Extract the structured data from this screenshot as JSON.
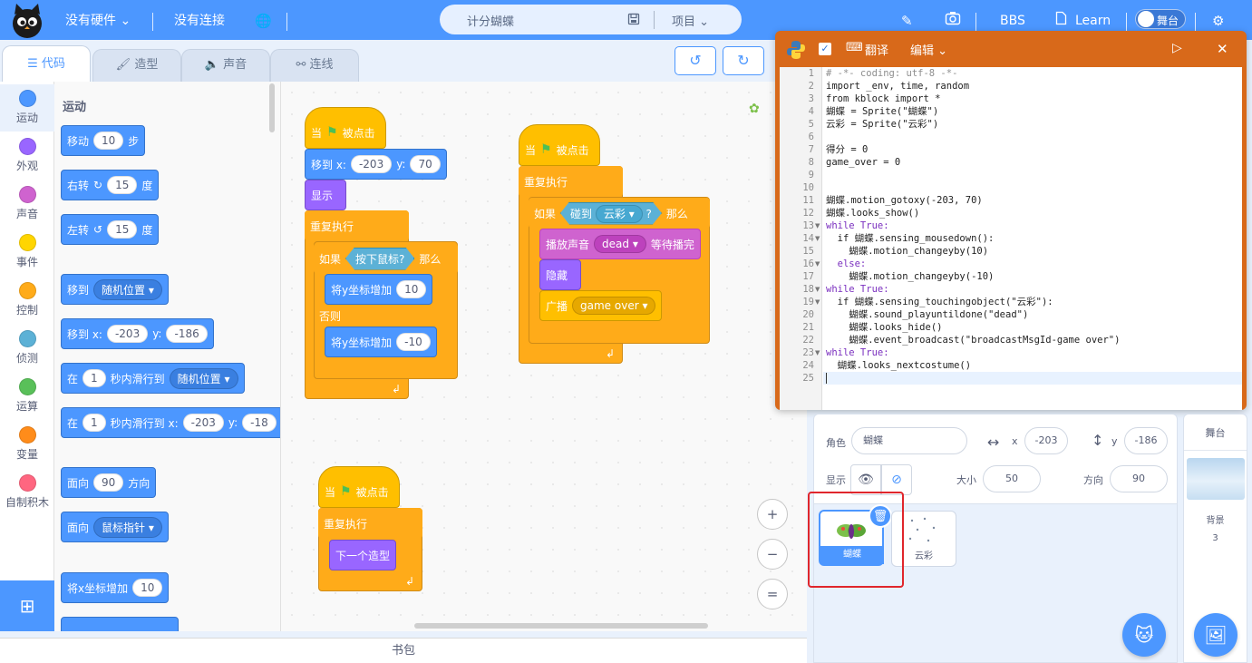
{
  "topbar": {
    "hardware": "没有硬件",
    "connection": "没有连接",
    "project_name": "计分蝴蝶",
    "project_menu": "项目",
    "bbs": "BBS",
    "learn": "Learn",
    "stage_toggle": "舞台"
  },
  "tabs": [
    "代码",
    "造型",
    "声音",
    "连线"
  ],
  "categories": [
    {
      "label": "运动",
      "color": "#4c97ff"
    },
    {
      "label": "外观",
      "color": "#9966ff"
    },
    {
      "label": "声音",
      "color": "#cf63cf"
    },
    {
      "label": "事件",
      "color": "#ffd500"
    },
    {
      "label": "控制",
      "color": "#ffab19"
    },
    {
      "label": "侦测",
      "color": "#5cb1d6"
    },
    {
      "label": "运算",
      "color": "#59c059"
    },
    {
      "label": "变量",
      "color": "#ff8c1a"
    },
    {
      "label": "自制积木",
      "color": "#ff6680"
    }
  ],
  "palette": {
    "title": "运动",
    "move": {
      "pre": "移动",
      "val": "10",
      "post": "步"
    },
    "turn_right": {
      "pre": "右转",
      "val": "15",
      "post": "度"
    },
    "turn_left": {
      "pre": "左转",
      "val": "15",
      "post": "度"
    },
    "goto_random": {
      "pre": "移到",
      "drop": "随机位置"
    },
    "goto_xy": {
      "pre": "移到 x:",
      "x": "-203",
      "ylabel": "y:",
      "y": "-186"
    },
    "glide_random": {
      "pre": "在",
      "val": "1",
      "mid": "秒内滑行到",
      "drop": "随机位置"
    },
    "glide_xy": {
      "pre": "在",
      "val": "1",
      "mid": "秒内滑行到 x:",
      "x": "-203",
      "ylabel": "y:",
      "y": "-18"
    },
    "point_dir": {
      "pre": "面向",
      "val": "90",
      "post": "方向"
    },
    "point_toward": {
      "pre": "面向",
      "drop": "鼠标指针"
    },
    "change_x": {
      "pre": "将x坐标增加",
      "val": "10"
    }
  },
  "script1": {
    "hat_pre": "当",
    "hat_post": "被点击",
    "goto_pre": "移到 x:",
    "goto_x": "-203",
    "goto_ylabel": "y:",
    "goto_y": "70",
    "show": "显示",
    "forever": "重复执行",
    "if": "如果",
    "cond": "按下鼠标?",
    "then": "那么",
    "change_y1_pre": "将y坐标增加",
    "change_y1_val": "10",
    "else": "否则",
    "change_y2_pre": "将y坐标增加",
    "change_y2_val": "-10"
  },
  "script2": {
    "hat_pre": "当",
    "hat_post": "被点击",
    "forever": "重复执行",
    "if": "如果",
    "touch_pre": "碰到",
    "touch_drop": "云彩",
    "touch_q": "?",
    "then": "那么",
    "sound_pre": "播放声音",
    "sound_drop": "dead",
    "sound_post": "等待播完",
    "hide": "隐藏",
    "broadcast_pre": "广播",
    "broadcast_drop": "game over"
  },
  "script3": {
    "hat_pre": "当",
    "hat_post": "被点击",
    "forever": "重复执行",
    "next": "下一个造型"
  },
  "zoom": {
    "in": "+",
    "out": "−",
    "reset": "="
  },
  "backpack": "书包",
  "python": {
    "translate": "翻译",
    "edit": "编辑",
    "line_numbers": [
      "1",
      "2",
      "3",
      "4",
      "5",
      "6",
      "7",
      "8",
      "9",
      "10",
      "11",
      "12",
      "13",
      "14",
      "15",
      "16",
      "17",
      "18",
      "19",
      "20",
      "21",
      "22",
      "23",
      "24",
      "25"
    ],
    "lines": [
      "# -*- coding: utf-8 -*-",
      "import _env, time, random",
      "from kblock import *",
      "蝴蝶 = Sprite(\"蝴蝶\")",
      "云彩 = Sprite(\"云彩\")",
      "",
      "得分 = 0",
      "game_over = 0",
      "",
      "",
      "蝴蝶.motion_gotoxy(-203, 70)",
      "蝴蝶.looks_show()",
      "while True:",
      "  if 蝴蝶.sensing_mousedown():",
      "    蝴蝶.motion_changeyby(10)",
      "  else:",
      "    蝴蝶.motion_changeyby(-10)",
      "while True:",
      "  if 蝴蝶.sensing_touchingobject(\"云彩\"):",
      "    蝴蝶.sound_playuntildone(\"dead\")",
      "    蝴蝶.looks_hide()",
      "    蝴蝶.event_broadcast(\"broadcastMsgId-game over\")",
      "while True:",
      "  蝴蝶.looks_nextcostume()",
      ""
    ]
  },
  "sprite_info": {
    "role_label": "角色",
    "role_name": "蝴蝶",
    "x_label": "x",
    "x": "-203",
    "y_label": "y",
    "y": "-186",
    "show_label": "显示",
    "size_label": "大小",
    "size": "50",
    "dir_label": "方向",
    "dir": "90"
  },
  "sprites": [
    "蝴蝶",
    "云彩"
  ],
  "stage": {
    "title": "舞台",
    "backdrop_label": "背景",
    "backdrop_count": "3"
  }
}
